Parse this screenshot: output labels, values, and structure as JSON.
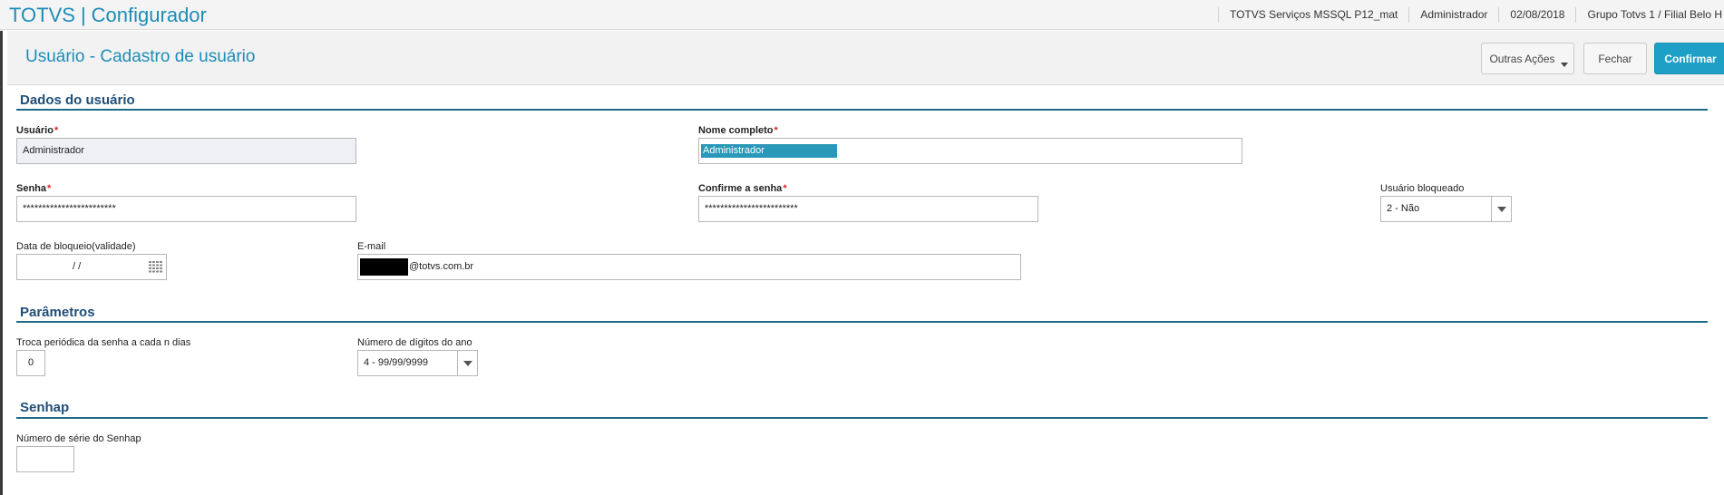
{
  "topbar": {
    "brand": "TOTVS",
    "brand_separator": "|",
    "app_name": "Configurador",
    "environment": "TOTVS Serviços MSSQL P12_mat",
    "user": "Administrador",
    "date": "02/08/2018",
    "branch": "Grupo Totvs 1 / Filial Belo H"
  },
  "header": {
    "title": "Usuário - Cadastro de usuário",
    "more_actions_label": "Outras Ações",
    "close_label": "Fechar",
    "confirm_label": "Confirmar"
  },
  "sections": {
    "user_data": "Dados do usuário",
    "parameters": "Parâmetros",
    "senhap": "Senhap"
  },
  "form": {
    "usuario": {
      "label": "Usuário",
      "required_mark": "*",
      "value": "Administrador"
    },
    "nome_completo": {
      "label": "Nome completo",
      "required_mark": "*",
      "value": "Administrador"
    },
    "senha": {
      "label": "Senha",
      "required_mark": "*",
      "value": "************************"
    },
    "confirme_senha": {
      "label": "Confirme a senha",
      "required_mark": "*",
      "value": "************************"
    },
    "usuario_bloqueado": {
      "label": "Usuário bloqueado",
      "value": "2 - Não"
    },
    "data_bloqueio": {
      "label": "Data de bloqueio(validade)",
      "value": "/ /"
    },
    "email": {
      "label": "E-mail",
      "value": "@totvs.com.br"
    },
    "troca_periodica": {
      "label": "Troca periódica da senha a cada n dias",
      "value": "0"
    },
    "digitos_ano": {
      "label": "Número de dígitos do ano",
      "value": "4 - 99/99/9999"
    },
    "serie_senhap": {
      "label": "Número de série do Senhap",
      "value": ""
    }
  },
  "icons": {
    "calendar": "calendar-icon",
    "dropdown": "chevron-down-icon"
  }
}
